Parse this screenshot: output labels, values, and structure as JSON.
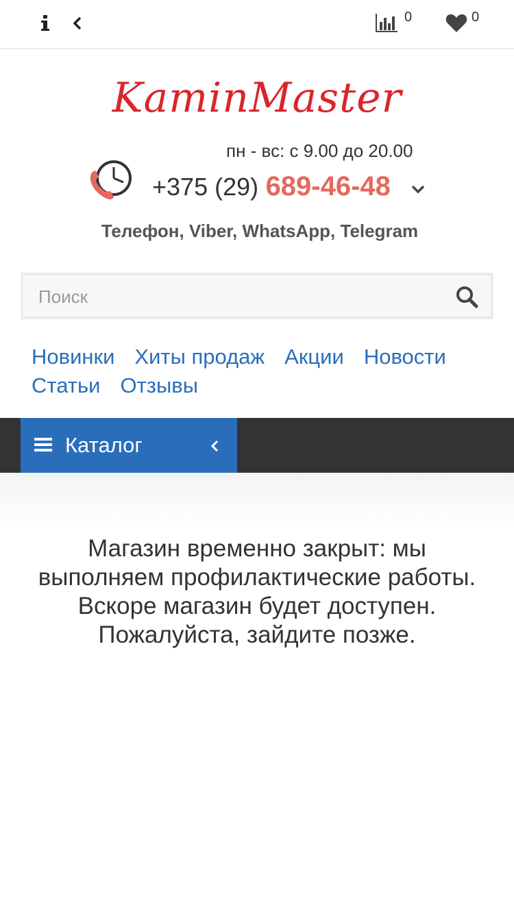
{
  "topbar": {
    "info_icon": "info-icon",
    "back_icon": "chevron-left-icon",
    "compare_icon": "bar-chart-icon",
    "compare_count": "0",
    "favorites_icon": "heart-icon",
    "favorites_count": "0"
  },
  "logo": {
    "text": "KaminMaster",
    "color": "#d9252b"
  },
  "contacts": {
    "hours": "пн - вс: с 9.00 до 20.00",
    "phone_prefix": "+375 (29)",
    "phone_number": "689-46-48",
    "phone_color": "#e36a5e",
    "messengers": "Телефон, Viber, WhatsApp, Telegram"
  },
  "search": {
    "placeholder": "Поиск",
    "value": ""
  },
  "nav": {
    "items": [
      "Новинки",
      "Хиты продаж",
      "Акции",
      "Новости",
      "Статьи",
      "Отзывы"
    ],
    "color": "#2a6ebb"
  },
  "catalog": {
    "label": "Каталог",
    "accent": "#2a6ebb",
    "bar_color": "#333333"
  },
  "message": {
    "lines": [
      "Магазин временно закрыт: мы",
      "выполняем профилактические работы.",
      "Вскоре магазин будет доступен.",
      "Пожалуйста, зайдите позже."
    ]
  }
}
